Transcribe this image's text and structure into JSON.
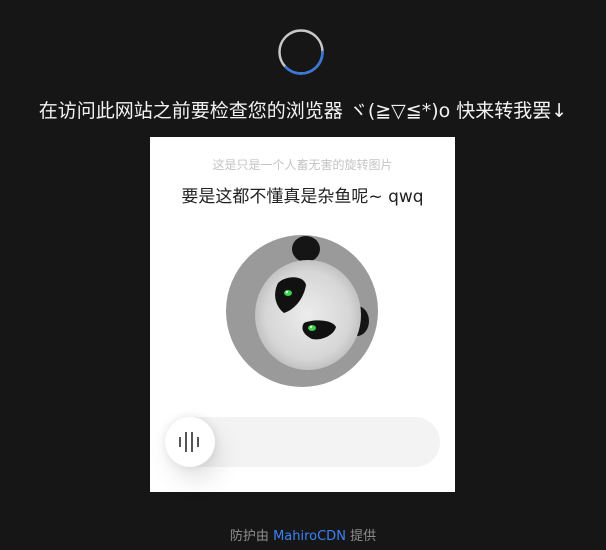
{
  "loader": {
    "icon": "loading-spinner-icon",
    "accent": "#3a78d8"
  },
  "headline": "在访问此网站之前要检查您的浏览器 ヾ(≧▽≦*)o 快来转我罢↓",
  "captcha": {
    "hint": "这是只是一个人畜无害的旋转图片",
    "title": "要是这都不懂真是杂鱼呢~ qwq",
    "image_icon": "panda-face-rotated-icon",
    "slider_icon": "grip-lines-icon",
    "rotation": 0
  },
  "footer": {
    "prefix": "防护由",
    "brand": "MahiroCDN",
    "suffix": "提供",
    "brand_color": "#3b82f6"
  }
}
